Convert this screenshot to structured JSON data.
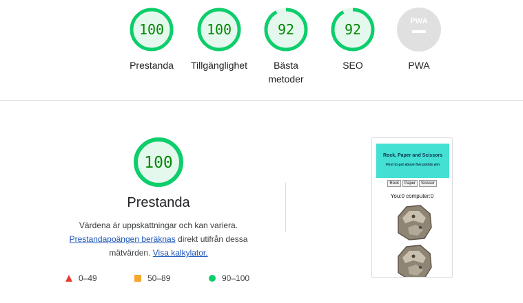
{
  "categories": [
    {
      "id": "performance",
      "score": 100,
      "label": "Prestanda",
      "fraction": 1.0
    },
    {
      "id": "accessibility",
      "score": 100,
      "label": "Tillgänglighet",
      "fraction": 1.0
    },
    {
      "id": "best-practices",
      "score": 92,
      "label": "Bästa metoder",
      "fraction": 0.92
    },
    {
      "id": "seo",
      "score": 92,
      "label": "SEO",
      "fraction": 0.92
    }
  ],
  "pwa": {
    "badge": "PWA",
    "label": "PWA"
  },
  "performance": {
    "score": 100,
    "title": "Prestanda",
    "desc_line1": "Värdena är uppskattningar och kan variera.",
    "calc_link": "Prestandapoängen beräknas",
    "desc_mid": " direkt utifrån dessa mätvärden. ",
    "calculator_link": "Visa kalkylator."
  },
  "legend": {
    "fail": "0–49",
    "average": "50–89",
    "pass": "90–100"
  },
  "thumbnail": {
    "title": "Rock, Paper and Scissors",
    "subtitle": "First to get above five points win",
    "buttons": [
      "Rock",
      "Paper",
      "Scissor"
    ],
    "score": "You:0 computer:0"
  },
  "colors": {
    "pass": "#0cce6b",
    "pass_bg": "#e5f8ee",
    "pass_text": "#008800",
    "average": "#f4a729",
    "fail": "#eb3b30",
    "pwa_gray": "#e0e0e0"
  }
}
